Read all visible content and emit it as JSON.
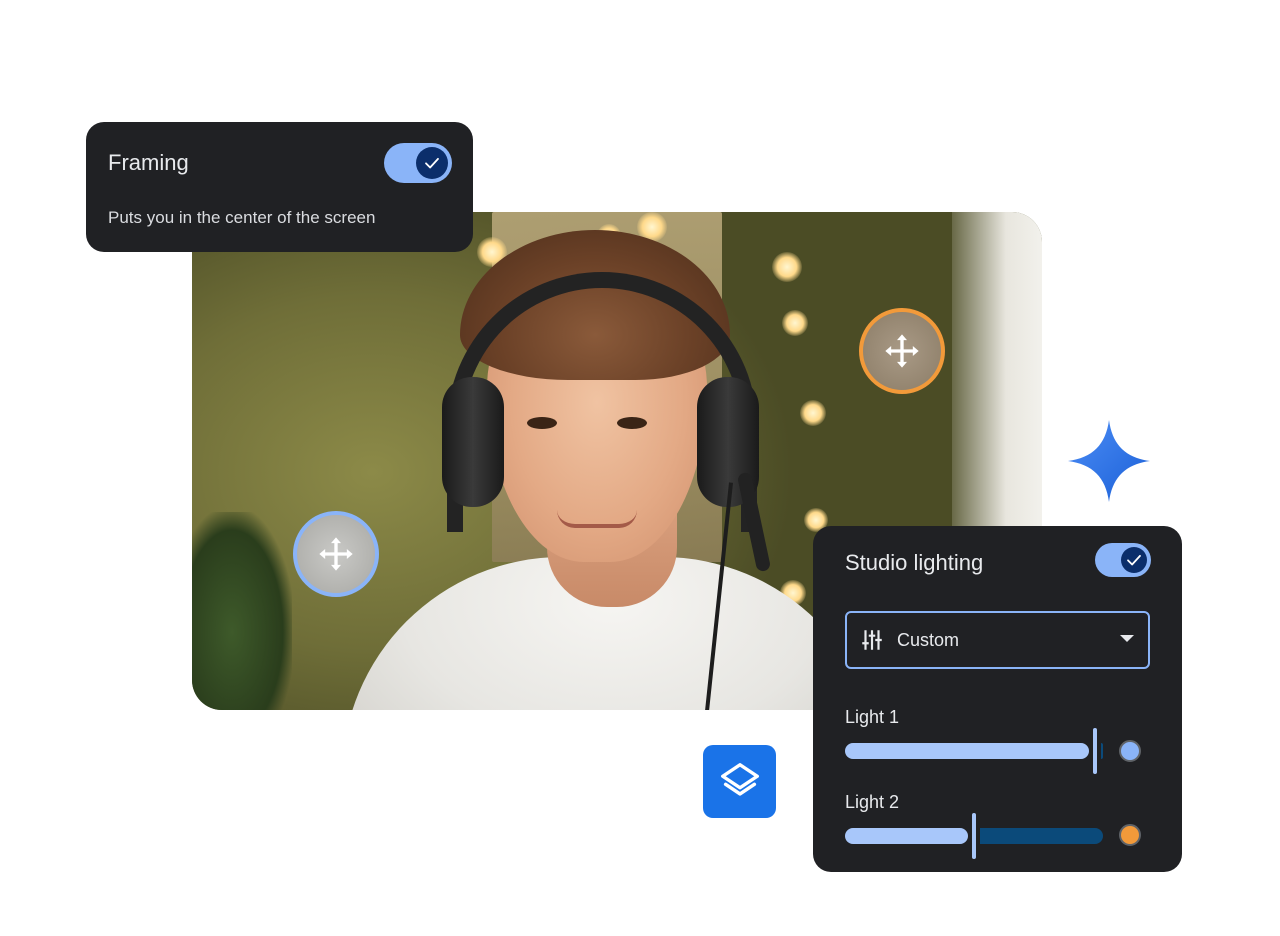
{
  "framing": {
    "title": "Framing",
    "description": "Puts you in the center of the screen",
    "enabled": true
  },
  "studio_lighting": {
    "title": "Studio lighting",
    "enabled": true,
    "mode": {
      "selected": "Custom",
      "icon": "tune-icon"
    },
    "lights": [
      {
        "label": "Light 1",
        "level": 0.97,
        "color": "#8ab4f8"
      },
      {
        "label": "Light 2",
        "level": 0.5,
        "color": "#f29a3a"
      }
    ]
  },
  "colors": {
    "card_bg": "#202124",
    "accent_blue": "#8ab4f8",
    "accent_orange": "#f29a3a",
    "toggle_knob": "#0b2e6b",
    "layers_button": "#1a73e8"
  },
  "icons": {
    "handle": "move-arrows-icon",
    "layers": "layers-icon",
    "sparkle": "sparkle-icon",
    "check": "check-icon"
  }
}
